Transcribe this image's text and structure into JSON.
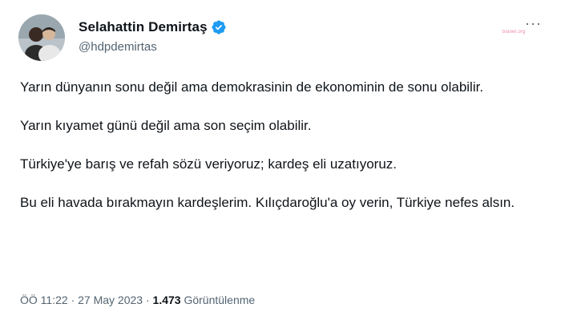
{
  "author": {
    "name": "Selahattin Demirtaş",
    "handle": "@hdpdemirtas",
    "verified_color": "#1d9bf0"
  },
  "watermark": "bianet.org",
  "more_icon": "more-dots-icon",
  "tweet": {
    "paragraphs": [
      "Yarın dünyanın sonu değil ama demokrasinin de ekonominin de sonu olabilir.",
      "Yarın kıyamet günü değil ama son seçim olabilir.",
      "Türkiye'ye barış ve refah sözü veriyoruz; kardeş eli uzatıyoruz.",
      "Bu eli havada bırakmayın kardeşlerim. Kılıçdaroğlu'a oy verin, Türkiye nefes alsın."
    ]
  },
  "meta": {
    "time": "ÖÖ 11:22",
    "date": "27 May 2023",
    "separator": "·",
    "views_count": "1.473",
    "views_label": "Görüntülenme"
  }
}
